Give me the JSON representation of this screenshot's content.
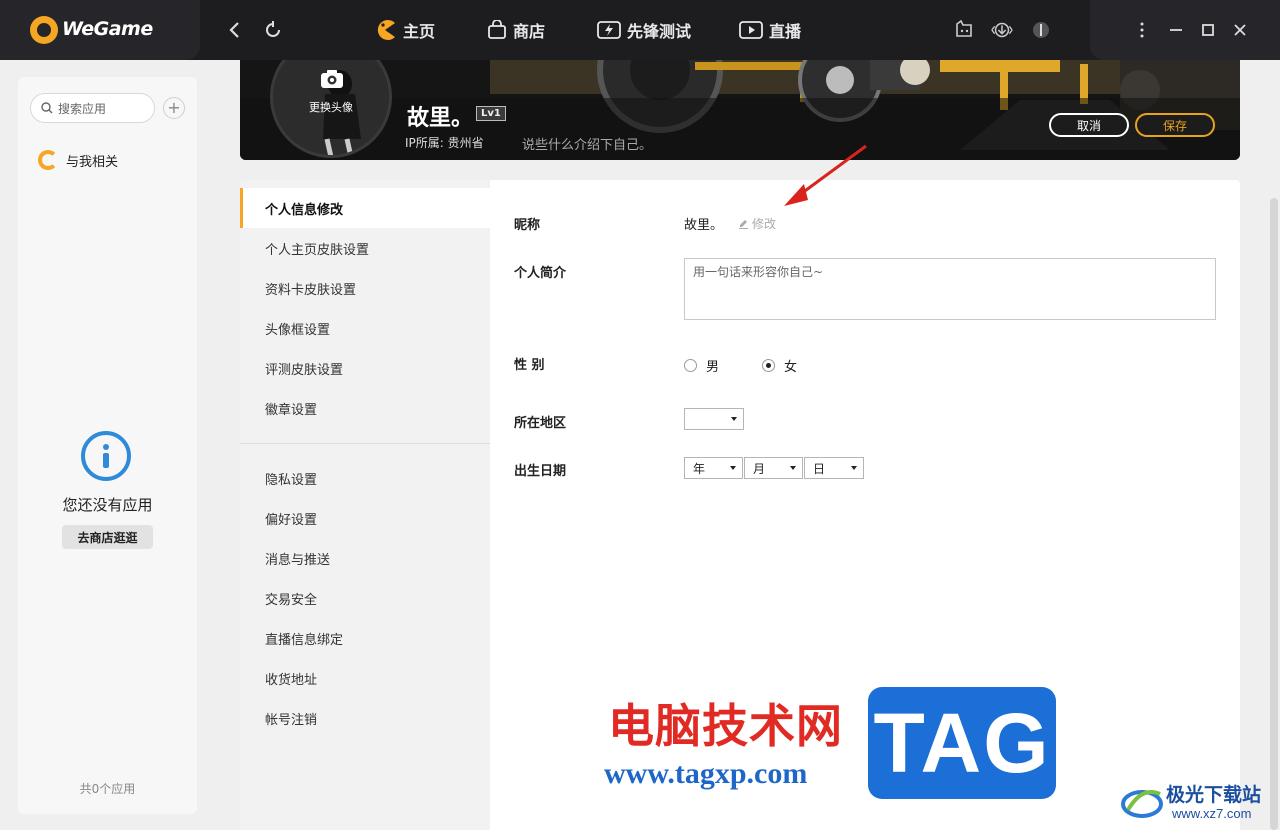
{
  "app": {
    "title": "WeGame"
  },
  "nav": {
    "tabs": [
      {
        "label": "主页"
      },
      {
        "label": "商店"
      },
      {
        "label": "先锋测试"
      },
      {
        "label": "直播"
      }
    ]
  },
  "sidebar": {
    "search_placeholder": "搜索应用",
    "related_label": "与我相关",
    "empty_text": "您还没有应用",
    "store_button": "去商店逛逛",
    "app_count": "共0个应用"
  },
  "profile": {
    "avatar_label": "更换头像",
    "name": "故里。",
    "level": "Lv1",
    "ip": "IP所属: 贵州省",
    "bio_prompt": "说些什么介绍下自己。",
    "cancel_label": "取消",
    "save_label": "保存"
  },
  "menu": {
    "items": [
      {
        "label": "个人信息修改",
        "active": true
      },
      {
        "label": "个人主页皮肤设置"
      },
      {
        "label": "资料卡皮肤设置"
      },
      {
        "label": "头像框设置"
      },
      {
        "label": "评测皮肤设置"
      },
      {
        "label": "徽章设置"
      },
      {
        "label": "隐私设置"
      },
      {
        "label": "偏好设置"
      },
      {
        "label": "消息与推送"
      },
      {
        "label": "交易安全"
      },
      {
        "label": "直播信息绑定"
      },
      {
        "label": "收货地址"
      },
      {
        "label": "帐号注销"
      }
    ]
  },
  "form": {
    "nickname_label": "昵称",
    "nickname_value": "故里。",
    "edit_label": "修改",
    "bio_label": "个人简介",
    "bio_placeholder": "用一句话来形容你自己~",
    "gender_label": "性 别",
    "gender_options": [
      {
        "label": "男",
        "selected": false
      },
      {
        "label": "女",
        "selected": true
      }
    ],
    "region_label": "所在地区",
    "region_value": "",
    "birth_label": "出生日期",
    "birth_year": "年",
    "birth_month": "月",
    "birth_day": "日"
  },
  "watermark": {
    "cn": "电脑技术网",
    "url": "www.tagxp.com",
    "tag": "TAG",
    "site_cn": "极光下载站",
    "site_url": "www.xz7.com"
  },
  "colors": {
    "accent": "#f5a623",
    "save": "#e8a31e",
    "topbar": "#1d1d1f"
  }
}
